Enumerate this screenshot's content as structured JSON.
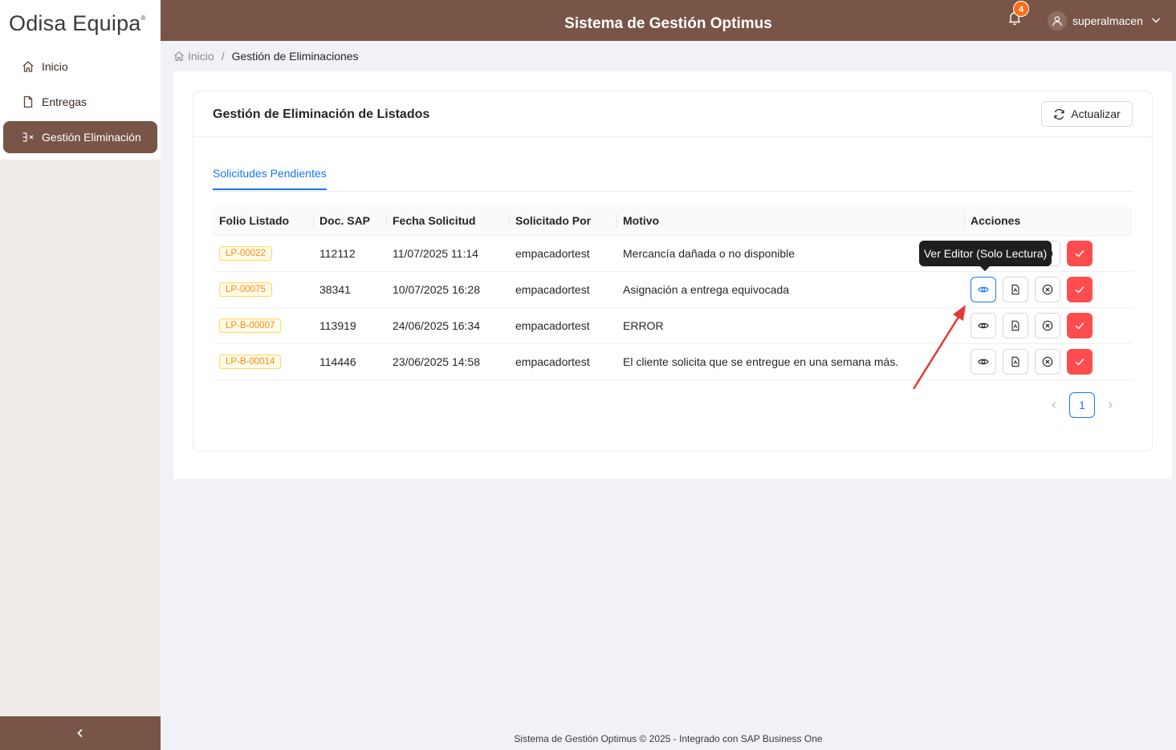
{
  "app": {
    "logo": "Odisa Equipa",
    "logo_mark": "®",
    "title": "Sistema de Gestión Optimus"
  },
  "header": {
    "notifications_count": "4",
    "username": "superalmacen"
  },
  "sidebar": {
    "items": [
      {
        "label": "Inicio",
        "icon": "home-icon"
      },
      {
        "label": "Entregas",
        "icon": "file-icon"
      },
      {
        "label": "Gestión Eliminación",
        "icon": "delete-list-icon",
        "active": true
      }
    ]
  },
  "breadcrumb": {
    "home": "Inicio",
    "separator": "/",
    "current": "Gestión de Eliminaciones"
  },
  "card": {
    "title": "Gestión de Eliminación de Listados",
    "refresh_label": "Actualizar"
  },
  "tabs": [
    {
      "label": "Solicitudes Pendientes",
      "active": true
    }
  ],
  "table": {
    "columns": [
      "Folio Listado",
      "Doc. SAP",
      "Fecha Solicitud",
      "Solicitado Por",
      "Motivo",
      "Acciones"
    ],
    "rows": [
      {
        "folio": "LP-00022",
        "doc": "112112",
        "fecha": "11/07/2025 11:14",
        "por": "empacadortest",
        "motivo": "Mercancía dañada o no disponible"
      },
      {
        "folio": "LP-00075",
        "doc": "38341",
        "fecha": "10/07/2025 16:28",
        "por": "empacadortest",
        "motivo": "Asignación a entrega equivocada"
      },
      {
        "folio": "LP-B-00007",
        "doc": "113919",
        "fecha": "24/06/2025 16:34",
        "por": "empacadortest",
        "motivo": "ERROR"
      },
      {
        "folio": "LP-B-00014",
        "doc": "114446",
        "fecha": "23/06/2025 14:58",
        "por": "empacadortest",
        "motivo": "El cliente solicita que se entregue en una semana más."
      }
    ]
  },
  "pagination": {
    "current": "1"
  },
  "tooltip": {
    "text": "Ver Editor (Solo Lectura)"
  },
  "footer": {
    "text": "Sistema de Gestión Optimus © 2025 - Integrado con SAP Business One"
  },
  "colors": {
    "brand": "#795548",
    "accent": "#1677ff",
    "danger": "#ff4d4f",
    "badge": "#fa6e1b",
    "annotation": "#e53935"
  }
}
